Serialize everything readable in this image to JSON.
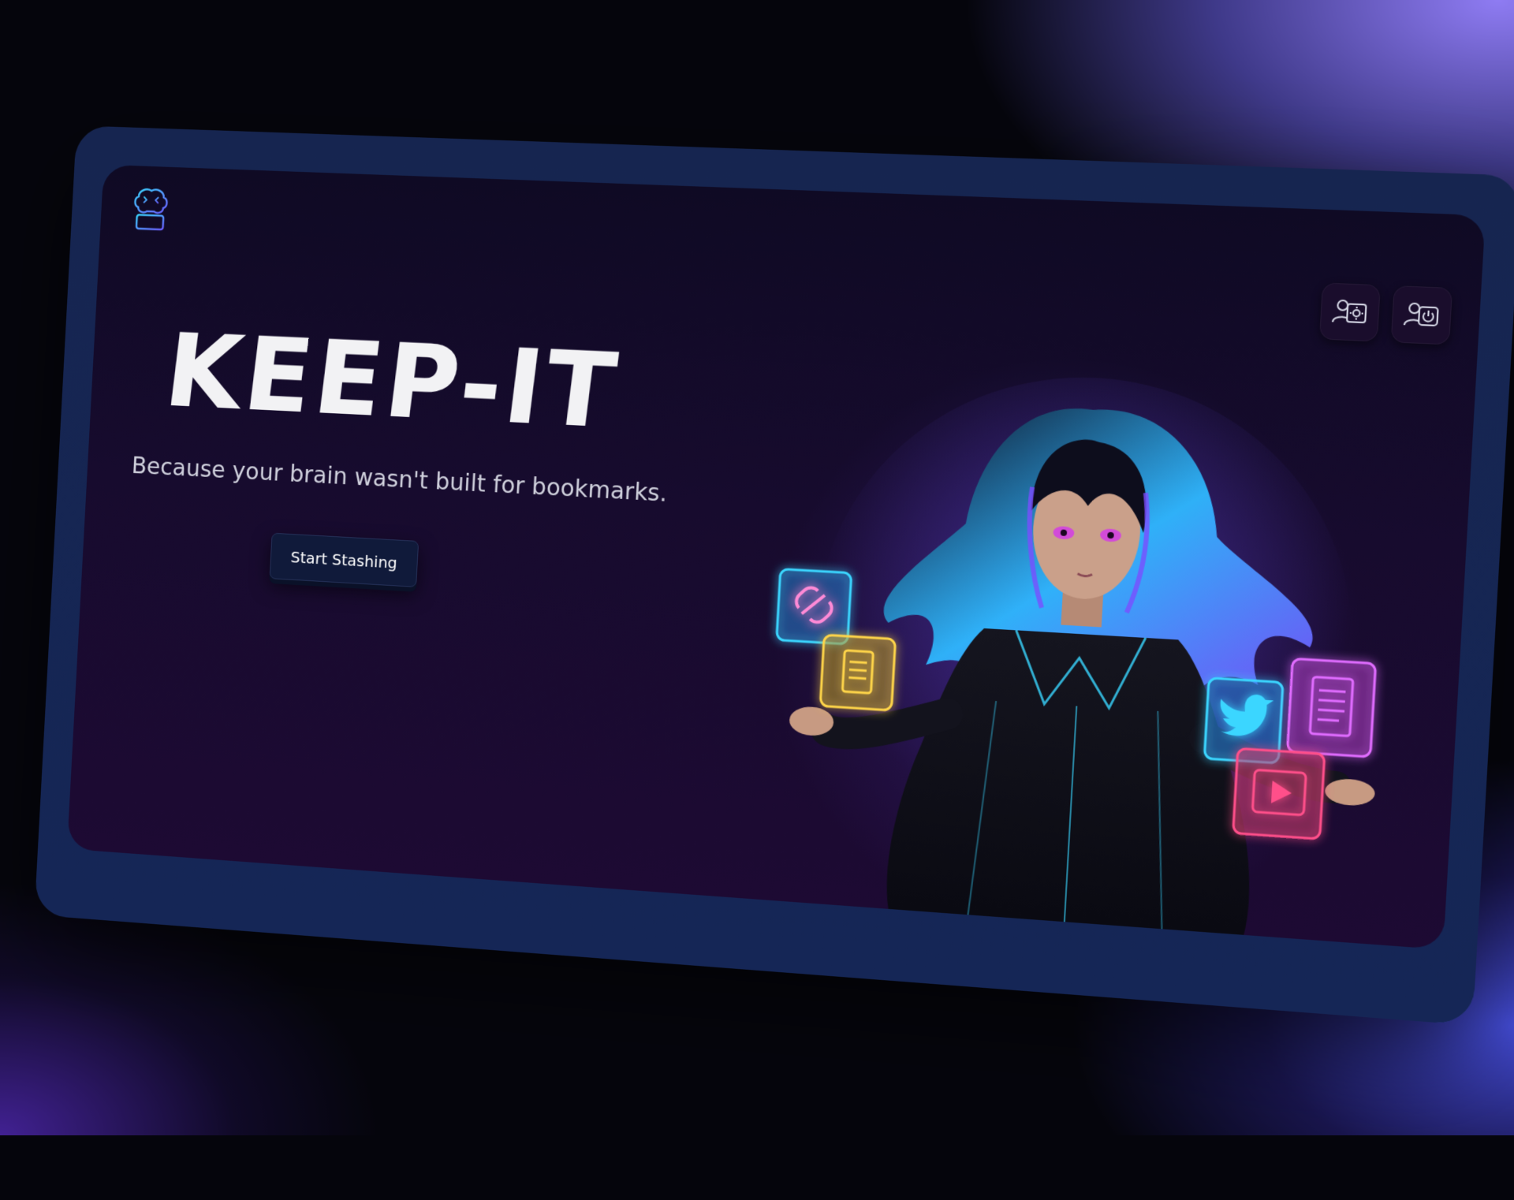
{
  "app": {
    "logo_icon": "brain-drawer-icon",
    "title": "KEEP-IT",
    "tagline": "Because your brain wasn't built for bookmarks."
  },
  "header": {
    "settings_icon": "user-settings-icon",
    "logout_icon": "user-logout-icon"
  },
  "hero": {
    "cta_label": "Start Stashing",
    "illustration_icons": [
      "link-icon",
      "document-icon",
      "twitter-icon",
      "document-icon",
      "play-video-icon"
    ]
  },
  "colors": {
    "screen_bg": "#170b2e",
    "frame_bg": "#162550",
    "accent_cyan": "#3ad6ff",
    "accent_purple": "#8a5cff",
    "accent_pink": "#ff4f8a",
    "accent_yellow": "#ffd54a",
    "text_primary": "#f2f2f4",
    "text_secondary": "#cfd0dc"
  }
}
